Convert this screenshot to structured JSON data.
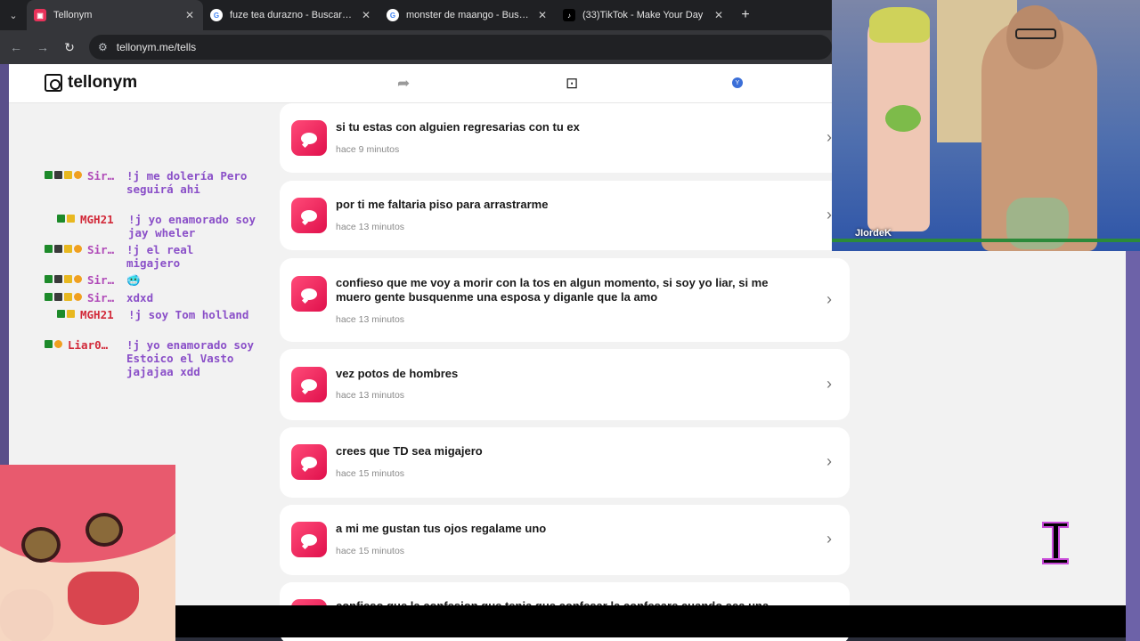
{
  "browser": {
    "tabs": [
      {
        "title": "Tellonym",
        "favicon": "tellonym-icon",
        "active": true
      },
      {
        "title": "fuze tea durazno - Buscar con G",
        "favicon": "google-icon",
        "active": false
      },
      {
        "title": "monster de maango - Buscar co",
        "favicon": "google-icon",
        "active": false
      },
      {
        "title": "(33)TikTok - Make Your Day",
        "favicon": "tiktok-icon",
        "active": false
      }
    ],
    "url": "tellonym.me/tells"
  },
  "app": {
    "logo": "tellonym",
    "avatar_letter": "Y",
    "accent": "#e8325a"
  },
  "tells": [
    {
      "text": "si tu estas con alguien regresarias con tu ex",
      "time": "hace 9 minutos"
    },
    {
      "text": "por ti me faltaria piso para arrastrarme",
      "time": "hace 13 minutos"
    },
    {
      "text": "confieso que me voy a morir con la tos en algun momento, si soy yo liar, si me muero gente busquenme una esposa y diganle que la amo",
      "time": "hace 13 minutos"
    },
    {
      "text": "vez potos de hombres",
      "time": "hace 13 minutos"
    },
    {
      "text": "crees que TD sea migajero",
      "time": "hace 15 minutos"
    },
    {
      "text": "a mi me gustan tus ojos regalame uno",
      "time": "hace 15 minutos"
    },
    {
      "text": "confieso que la confesion que tenia que confesar la confesare cuando sea una",
      "time": ""
    }
  ],
  "chat": [
    {
      "user": "Sir…",
      "text": "!j me dolería Pero seguirá ahi"
    },
    {
      "user": "MGH21",
      "text": "!j yo enamorado soy jay wheler"
    },
    {
      "user": "Sir…",
      "text": "!j el real migajero"
    },
    {
      "user": "Sir…",
      "text": "🥶"
    },
    {
      "user": "Sir…",
      "text": "xdxd"
    },
    {
      "user": "MGH21",
      "text": "!j soy Tom holland"
    },
    {
      "user": "Liar0…",
      "text": "!j yo enamorado soy Estoico el Vasto jajajaa xdd"
    }
  ],
  "webcam": {
    "overlay_name": "JIordeK"
  }
}
